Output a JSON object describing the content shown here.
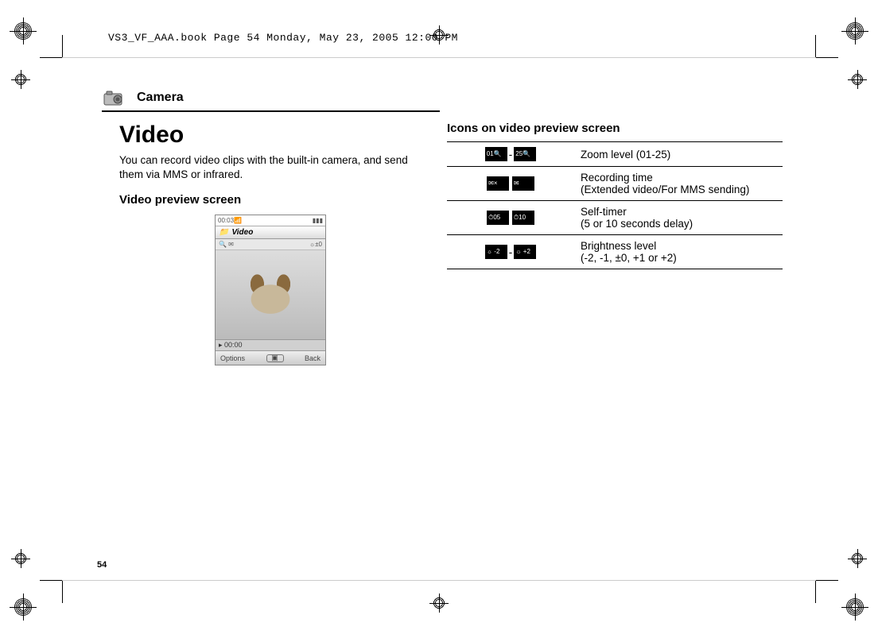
{
  "header_stamp": "VS3_VF_AAA.book  Page 54  Monday, May 23, 2005  12:00 PM",
  "section_title": "Camera",
  "page_heading": "Video",
  "intro_text": "You can record video clips with the built-in camera, and send them via MMS or infrared.",
  "preview_heading": "Video preview screen",
  "phone": {
    "status_time": "00:03",
    "titlebar": "Video",
    "iconrow_left": "🔍 ✉",
    "iconrow_right": "☼±0",
    "timer": "▸ 00:00",
    "softkey_left": "Options",
    "softkey_right": "Back"
  },
  "icons_heading": "Icons on video preview screen",
  "icon_rows": [
    {
      "icon_label_a": "01🔍",
      "icon_label_b": "25🔍",
      "separator": "-",
      "desc": "Zoom level (01-25)"
    },
    {
      "icon_label_a": "✉×",
      "icon_label_b": "✉",
      "separator": "",
      "desc": "Recording time\n(Extended video/For MMS sending)"
    },
    {
      "icon_label_a": "⏱05",
      "icon_label_b": "⏱10",
      "separator": "",
      "desc": "Self-timer\n(5 or 10 seconds delay)"
    },
    {
      "icon_label_a": "☼ -2",
      "icon_label_b": "☼ +2",
      "separator": "-",
      "desc": "Brightness level\n(-2, -1, ±0, +1 or +2)"
    }
  ],
  "page_number": "54"
}
